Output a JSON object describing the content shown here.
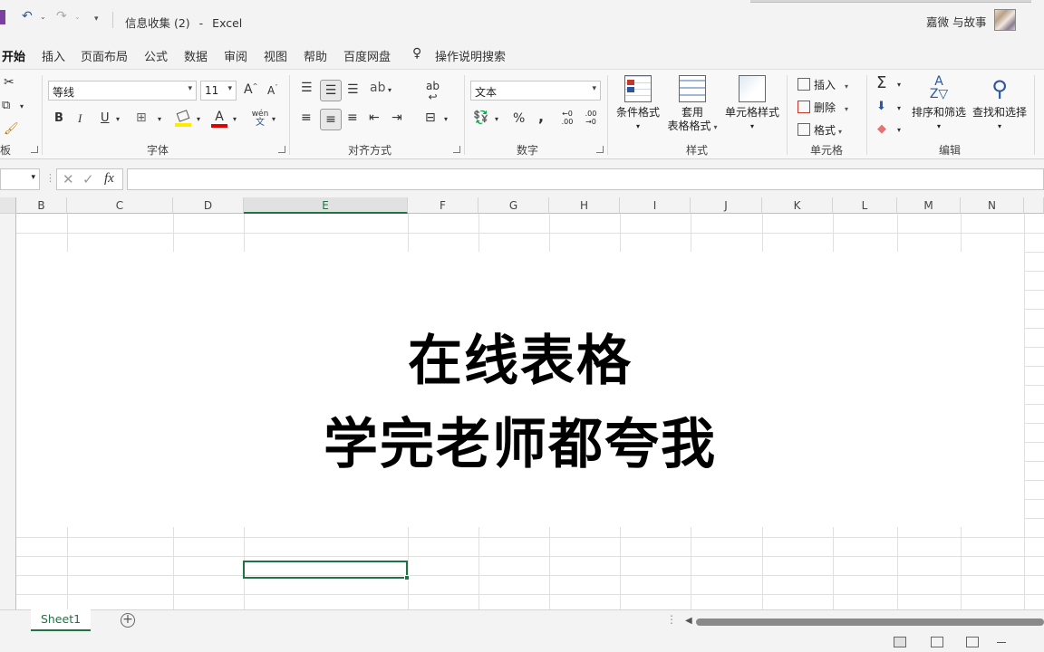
{
  "title": {
    "document": "信息收集 (2)",
    "dash": "-",
    "app": "Excel",
    "user": "嘉微 与故事"
  },
  "menu": {
    "tabs": [
      "开始",
      "插入",
      "页面布局",
      "公式",
      "数据",
      "审阅",
      "视图",
      "帮助",
      "百度网盘"
    ],
    "search_placeholder": "操作说明搜索"
  },
  "ribbon": {
    "font_name": "等线",
    "font_size": "11",
    "number_format": "文本",
    "groups": {
      "clipboard_partial": "板",
      "font": "字体",
      "alignment": "对齐方式",
      "number": "数字",
      "styles": "样式",
      "cells": "单元格",
      "editing": "编辑"
    },
    "styles": {
      "conditional": "条件格式",
      "table_1": "套用",
      "table_2": "表格格式",
      "cell_styles": "单元格样式"
    },
    "cells": {
      "insert": "插入",
      "delete": "删除",
      "format": "格式"
    },
    "editing": {
      "sort_filter": "排序和筛选",
      "find_select": "查找和选择"
    },
    "font_buttons": {
      "bold": "B",
      "italic": "I",
      "underline": "U",
      "grow": "A",
      "shrink": "A",
      "font_color": "A",
      "phonetic": "wén"
    },
    "number_buttons": {
      "percent": "%",
      "comma": ",",
      "inc_decimal": ".00",
      "dec_decimal": ".00",
      "sigma": "Σ"
    }
  },
  "formula_bar": {
    "fx": "fx",
    "value": ""
  },
  "columns": [
    "B",
    "C",
    "D",
    "E",
    "F",
    "G",
    "H",
    "I",
    "J",
    "K",
    "L",
    "M",
    "N"
  ],
  "selected_column": "E",
  "overlay": {
    "line1": "在线表格",
    "line2": "学完老师都夸我"
  },
  "sheets": [
    "Sheet1"
  ],
  "colors": {
    "accent": "#217346",
    "quick_access": "#2b579a"
  }
}
